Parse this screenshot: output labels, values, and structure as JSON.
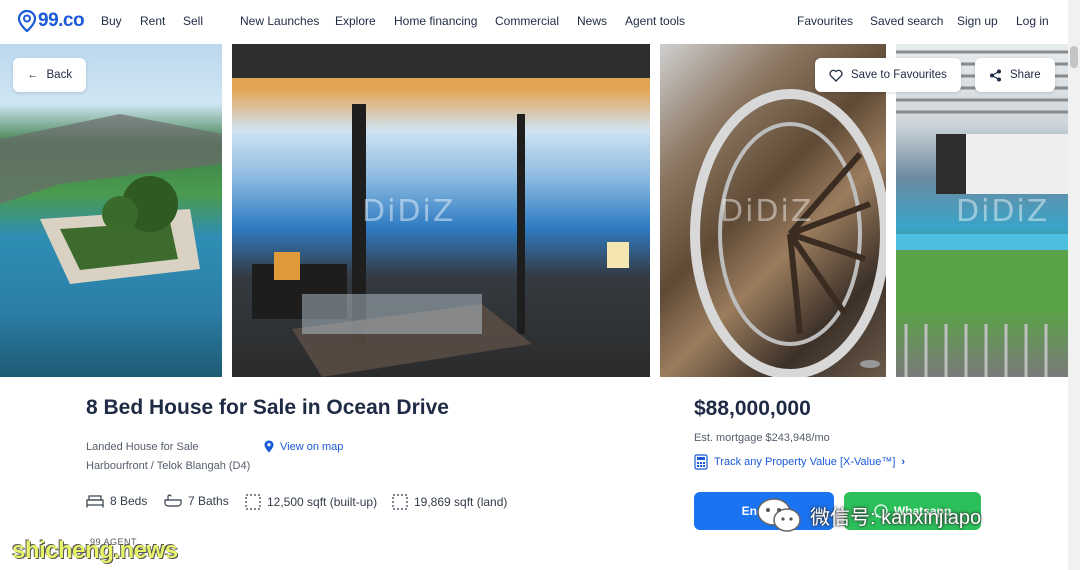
{
  "nav": {
    "logo": "99.co",
    "left_links": [
      "Buy",
      "Rent",
      "Sell",
      "New Launches",
      "Explore",
      "Home financing",
      "Commercial",
      "News",
      "Agent tools"
    ],
    "right_links": [
      "Favourites",
      "Saved search",
      "Sign up",
      "Log in"
    ]
  },
  "gallery": {
    "back_label": "Back",
    "save_label": "Save to Favourites",
    "share_label": "Share",
    "watermark": "DiDiZ"
  },
  "listing": {
    "title": "8 Bed House for Sale in Ocean Drive",
    "property_type": "Landed House for Sale",
    "address": "Harbourfront / Telok Blangah (D4)",
    "view_map": "View on map",
    "beds": "8 Beds",
    "baths": "7 Baths",
    "built_up": "12,500 sqft (built-up)",
    "land": "19,869 sqft (land)",
    "agent_label": "99 AGENT"
  },
  "pricing": {
    "price": "$88,000,000",
    "mortgage": "Est. mortgage $243,948/mo",
    "xvalue": "Track any Property Value [X-Value™]",
    "enquire_label": "Enquire",
    "whatsapp_label": "Whatsapp"
  },
  "overlays": {
    "wechat_text": "微信号: kanxinjiapo",
    "site_watermark": "shicheng.news"
  },
  "colors": {
    "brand": "#1a5ad7",
    "enquire": "#1a73f0",
    "whatsapp": "#2bbf5a"
  }
}
